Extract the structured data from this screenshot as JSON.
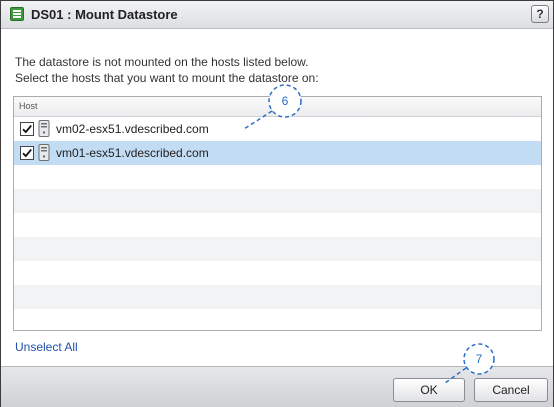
{
  "dialog": {
    "title": "DS01 : Mount Datastore",
    "help_label": "?",
    "description_line1": "The datastore is not mounted on the hosts listed below.",
    "description_line2": "Select the hosts that you want to mount the datastore on:"
  },
  "grid": {
    "column_header": "Host",
    "rows": [
      {
        "label": "vm02-esx51.vdescribed.com",
        "checked": true,
        "selected": false
      },
      {
        "label": "vm01-esx51.vdescribed.com",
        "checked": true,
        "selected": true
      }
    ]
  },
  "actions": {
    "unselect_all": "Unselect All",
    "ok_label": "OK",
    "cancel_label": "Cancel"
  },
  "callouts": {
    "callout_6": "6",
    "callout_7": "7"
  },
  "colors": {
    "selected_row": "#c2dcf3",
    "link": "#2050a8",
    "callout": "#2a6fc9"
  },
  "icons": {
    "title": "datastore-icon",
    "help": "help-icon",
    "checkbox": "checkmark-icon",
    "host": "host-server-icon"
  }
}
